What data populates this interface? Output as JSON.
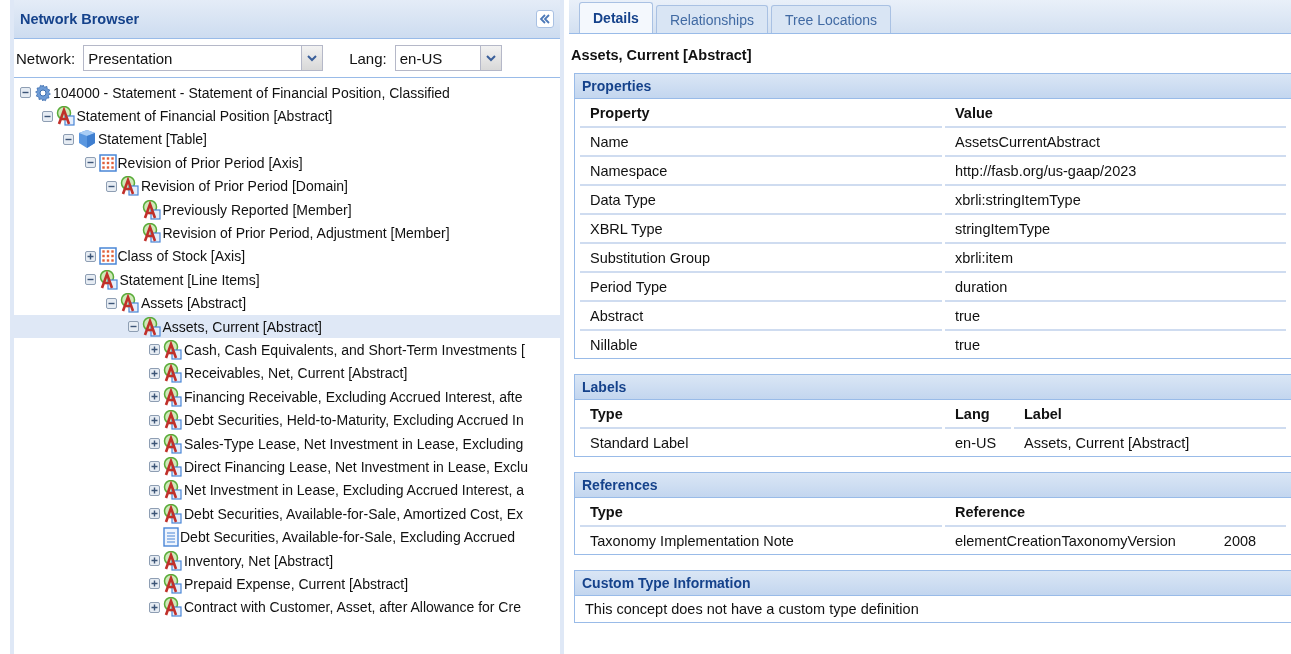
{
  "network_browser": {
    "title": "Network Browser",
    "network": {
      "label": "Network:",
      "value": "Presentation"
    },
    "lang": {
      "label": "Lang:",
      "value": "en-US"
    },
    "tree": [
      {
        "label": "104000 - Statement - Statement of Financial Position, Classified",
        "kind": "network",
        "expanded": true,
        "selected": false,
        "children": [
          {
            "label": "Statement of Financial Position [Abstract]",
            "kind": "abstract",
            "expanded": true,
            "selected": false,
            "children": [
              {
                "label": "Statement [Table]",
                "kind": "table",
                "expanded": true,
                "selected": false,
                "children": [
                  {
                    "label": "Revision of Prior Period [Axis]",
                    "kind": "axis",
                    "expanded": true,
                    "selected": false,
                    "children": [
                      {
                        "label": "Revision of Prior Period [Domain]",
                        "kind": "abstract",
                        "expanded": true,
                        "selected": false,
                        "children": [
                          {
                            "label": "Previously Reported [Member]",
                            "kind": "abstract",
                            "selected": false
                          },
                          {
                            "label": "Revision of Prior Period, Adjustment [Member]",
                            "kind": "abstract",
                            "selected": false
                          }
                        ]
                      }
                    ]
                  },
                  {
                    "label": "Class of Stock [Axis]",
                    "kind": "axis",
                    "expanded": false,
                    "selected": false
                  },
                  {
                    "label": "Statement [Line Items]",
                    "kind": "abstract",
                    "expanded": true,
                    "selected": false,
                    "children": [
                      {
                        "label": "Assets [Abstract]",
                        "kind": "abstract",
                        "expanded": true,
                        "selected": false,
                        "children": [
                          {
                            "label": "Assets, Current [Abstract]",
                            "kind": "abstract",
                            "expanded": true,
                            "selected": true,
                            "children": [
                              {
                                "label": "Cash, Cash Equivalents, and Short-Term Investments [",
                                "kind": "abstract",
                                "expanded": false,
                                "selected": false
                              },
                              {
                                "label": "Receivables, Net, Current [Abstract]",
                                "kind": "abstract",
                                "expanded": false,
                                "selected": false
                              },
                              {
                                "label": "Financing Receivable, Excluding Accrued Interest, afte",
                                "kind": "abstract",
                                "expanded": false,
                                "selected": false
                              },
                              {
                                "label": "Debt Securities, Held-to-Maturity, Excluding Accrued In",
                                "kind": "abstract",
                                "expanded": false,
                                "selected": false
                              },
                              {
                                "label": "Sales-Type Lease, Net Investment in Lease, Excluding",
                                "kind": "abstract",
                                "expanded": false,
                                "selected": false
                              },
                              {
                                "label": "Direct Financing Lease, Net Investment in Lease, Exclu",
                                "kind": "abstract",
                                "expanded": false,
                                "selected": false
                              },
                              {
                                "label": "Net Investment in Lease, Excluding Accrued Interest, a",
                                "kind": "abstract",
                                "expanded": false,
                                "selected": false
                              },
                              {
                                "label": "Debt Securities, Available-for-Sale, Amortized Cost, Ex",
                                "kind": "abstract",
                                "expanded": false,
                                "selected": false
                              },
                              {
                                "label": "Debt Securities, Available-for-Sale, Excluding Accrued",
                                "kind": "text",
                                "selected": false
                              },
                              {
                                "label": "Inventory, Net [Abstract]",
                                "kind": "abstract",
                                "expanded": false,
                                "selected": false
                              },
                              {
                                "label": "Prepaid Expense, Current [Abstract]",
                                "kind": "abstract",
                                "expanded": false,
                                "selected": false
                              },
                              {
                                "label": "Contract with Customer, Asset, after Allowance for Cre",
                                "kind": "abstract",
                                "expanded": false,
                                "selected": false
                              }
                            ]
                          }
                        ]
                      }
                    ]
                  }
                ]
              }
            ]
          }
        ]
      }
    ]
  },
  "details": {
    "tabs": [
      {
        "label": "Details",
        "selected": true
      },
      {
        "label": "Relationships",
        "selected": false
      },
      {
        "label": "Tree Locations",
        "selected": false
      }
    ],
    "concept_title": "Assets, Current [Abstract]",
    "properties": {
      "title": "Properties",
      "columns": [
        "Property",
        "Value"
      ],
      "rows": [
        [
          "Name",
          "AssetsCurrentAbstract"
        ],
        [
          "Namespace",
          "http://fasb.org/us-gaap/2023"
        ],
        [
          "Data Type",
          "xbrli:stringItemType"
        ],
        [
          "XBRL Type",
          "stringItemType"
        ],
        [
          "Substitution Group",
          "xbrli:item"
        ],
        [
          "Period Type",
          "duration"
        ],
        [
          "Abstract",
          "true"
        ],
        [
          "Nillable",
          "true"
        ]
      ]
    },
    "labels": {
      "title": "Labels",
      "columns": [
        "Type",
        "Lang",
        "Label"
      ],
      "rows": [
        [
          "Standard Label",
          "en-US",
          "Assets, Current [Abstract]"
        ]
      ]
    },
    "references": {
      "title": "References",
      "columns": [
        "Type",
        "Reference"
      ],
      "rows": [
        {
          "type": "Taxonomy Implementation Note",
          "reference": "elementCreationTaxonomyVersion",
          "value": "2008"
        }
      ]
    },
    "custom_type": {
      "title": "Custom Type Information",
      "text": "This concept does not have a custom type definition"
    }
  }
}
